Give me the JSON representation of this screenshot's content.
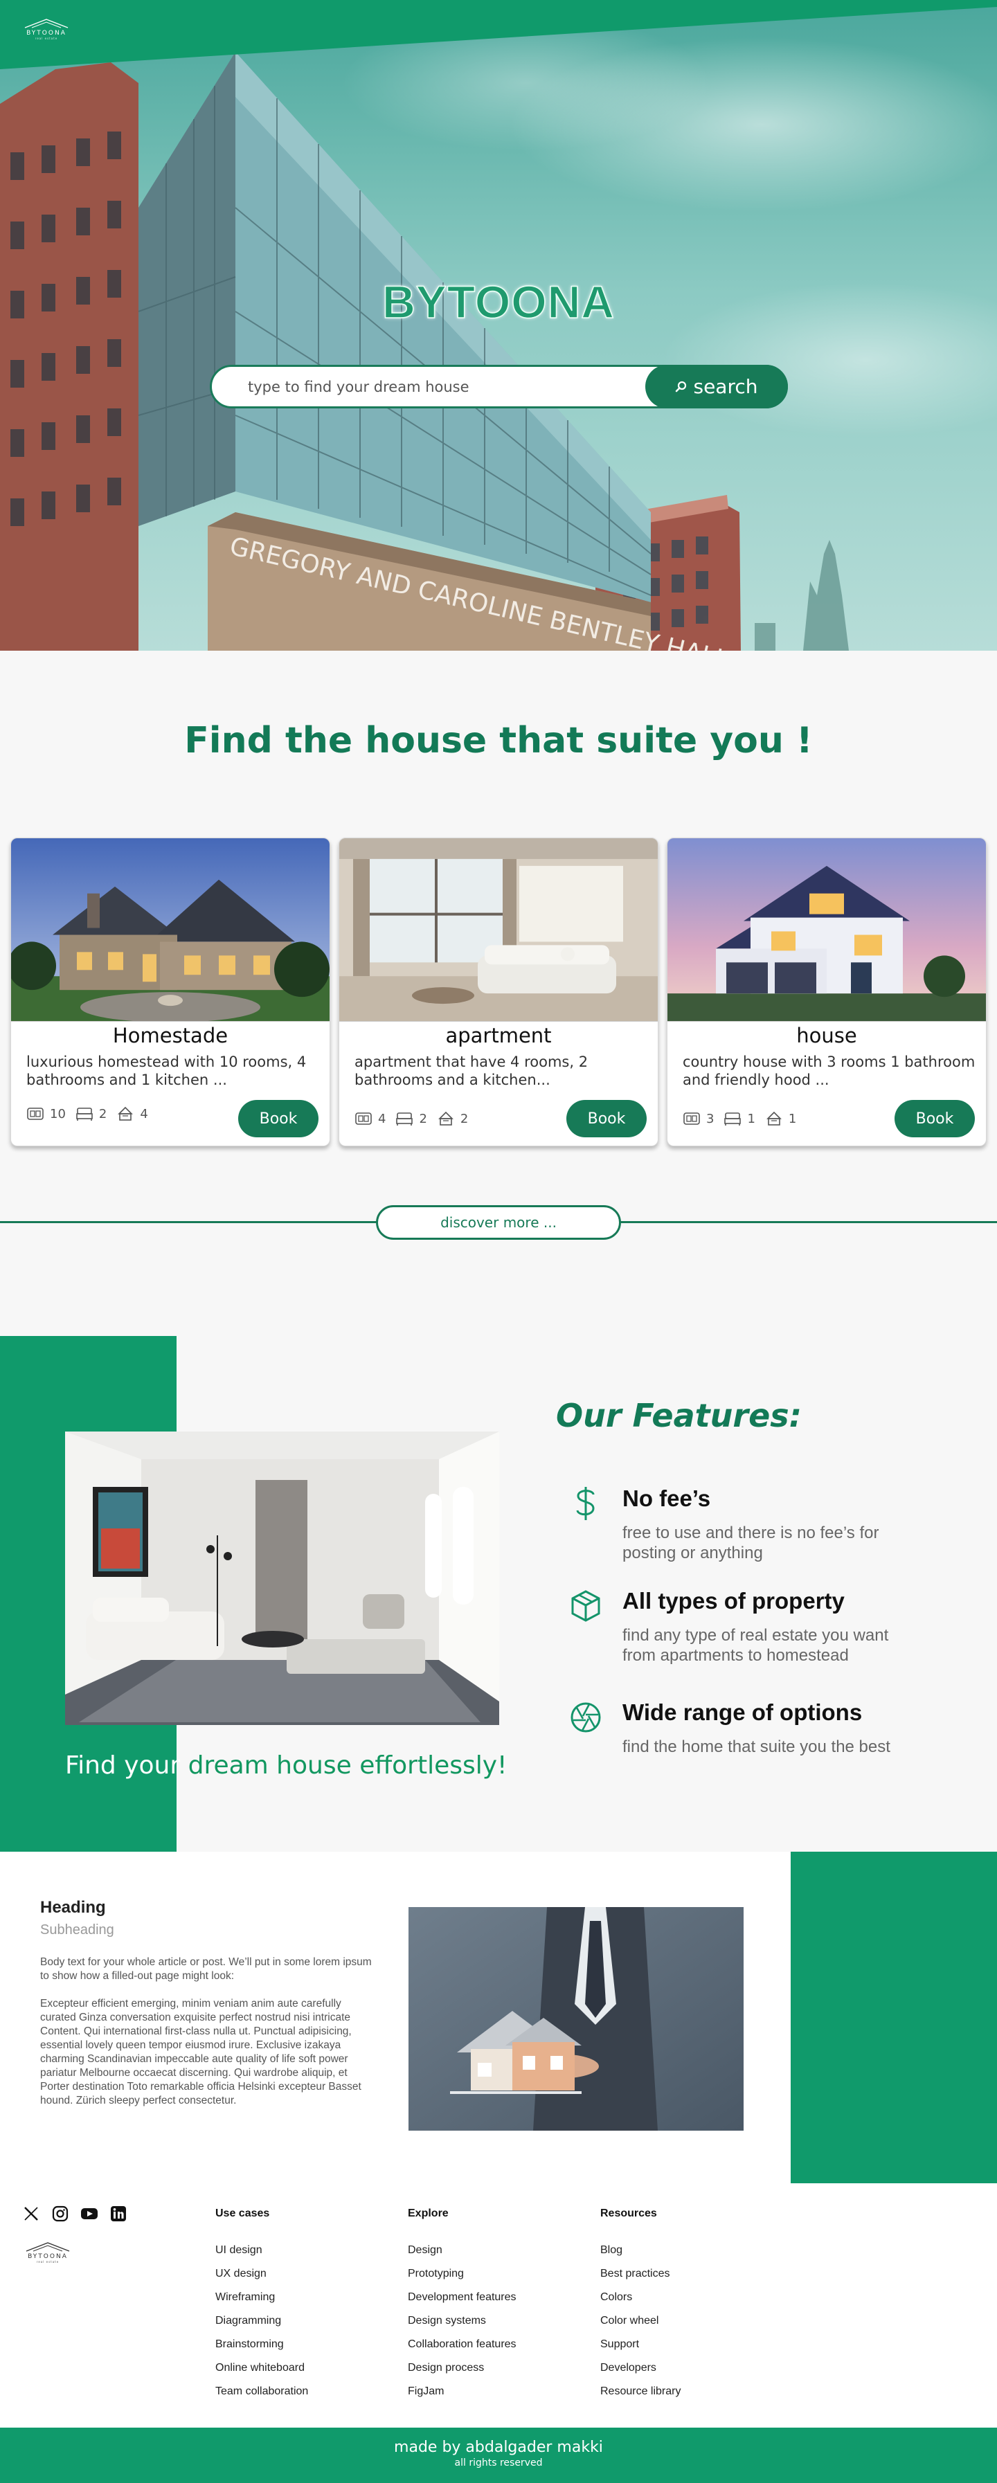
{
  "brand": {
    "name": "BYTOONA",
    "tagline": "real estate"
  },
  "hero": {
    "title": "BYTOONA",
    "building_sign": "GREGORY AND CAROLINE BENTLEY HALL",
    "search": {
      "placeholder": "type to find your dream house",
      "button_label": "search"
    }
  },
  "listings": {
    "title": "Find the house that suite you !",
    "cards": [
      {
        "name": "Homestade",
        "description": "luxurious homestead with 10 rooms, 4 bathrooms and 1 kitchen ...",
        "rooms": "10",
        "bathrooms": "2",
        "kitchens": "4",
        "book_label": "Book"
      },
      {
        "name": "apartment",
        "description": "apartment that have 4 rooms, 2 bathrooms and a kitchen...",
        "rooms": "4",
        "bathrooms": "2",
        "kitchens": "2",
        "book_label": "Book"
      },
      {
        "name": "house",
        "description": "country house with 3 rooms 1 bathroom and friendly hood ...",
        "rooms": "3",
        "bathrooms": "1",
        "kitchens": "1",
        "book_label": "Book"
      }
    ],
    "discover_label": "discover more ..."
  },
  "features": {
    "title": "Our Features:",
    "caption_part1": "Find your",
    "caption_part2": " dream house effortlessly!",
    "items": [
      {
        "icon": "dollar-icon",
        "name": "No fee’s",
        "description": "free to use and there is no fee’s for posting or anything"
      },
      {
        "icon": "cube-icon",
        "name": "All types of property",
        "description": "find any type of real estate you want from apartments to homestead"
      },
      {
        "icon": "aperture-icon",
        "name": "Wide range of options",
        "description": "find the home that suite you the best"
      }
    ]
  },
  "article": {
    "heading": "Heading",
    "subheading": "Subheading",
    "body": "Body text for your whole article or post. We’ll put in some lorem ipsum to show how a filled-out page might look:\n\nExcepteur efficient emerging, minim veniam anim aute carefully curated Ginza conversation exquisite perfect nostrud nisi intricate Content. Qui  international first-class nulla ut. Punctual adipisicing, essential lovely queen tempor eiusmod irure. Exclusive izakaya charming Scandinavian impeccable aute quality of life soft power pariatur Melbourne occaecat discerning. Qui wardrobe aliquip, et Porter destination Toto remarkable officia Helsinki excepteur Basset hound. Zürich sleepy perfect consectetur."
  },
  "footer": {
    "social": [
      "x-icon",
      "instagram-icon",
      "youtube-icon",
      "linkedin-icon"
    ],
    "columns": [
      {
        "title": "Use cases",
        "links": [
          "UI design",
          "UX design",
          "Wireframing",
          "Diagramming",
          "Brainstorming",
          "Online whiteboard",
          "Team collaboration"
        ]
      },
      {
        "title": "Explore",
        "links": [
          "Design",
          "Prototyping",
          "Development features",
          "Design systems",
          "Collaboration features",
          "Design process",
          "FigJam"
        ]
      },
      {
        "title": "Resources",
        "links": [
          "Blog",
          "Best practices",
          "Colors",
          "Color wheel",
          "Support",
          "Developers",
          "Resource library"
        ]
      }
    ],
    "credit": "made by abdalgader makki",
    "rights": "all rights reserved"
  },
  "colors": {
    "brand_green": "#109a6b",
    "dark_green": "#177a57",
    "background": "#f7f7f7"
  }
}
